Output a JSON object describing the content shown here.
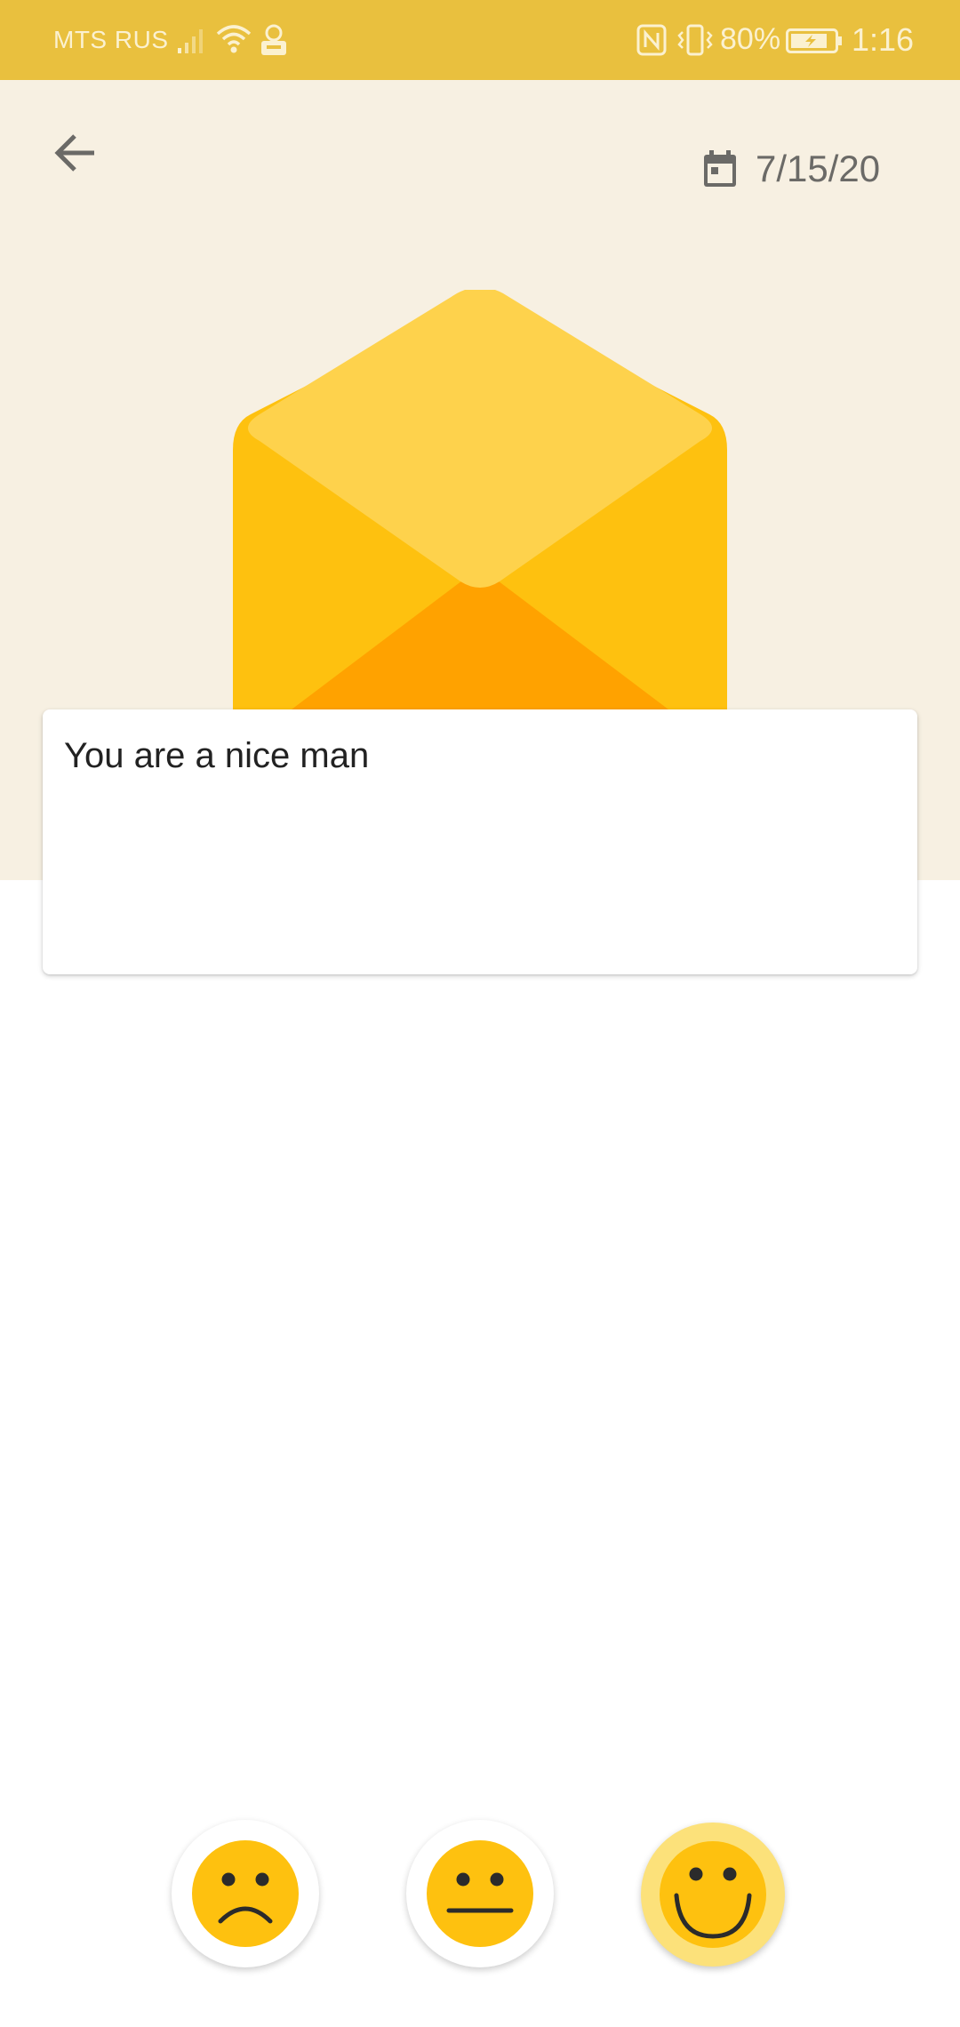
{
  "status_bar": {
    "carrier": "MTS RUS",
    "battery_percent": "80%",
    "time": "1:16",
    "icons": [
      "signal-icon",
      "wifi-icon",
      "vpn-icon",
      "nfc-icon",
      "vibrate-icon",
      "battery-charging-icon"
    ]
  },
  "header": {
    "back_icon": "arrow-left-icon",
    "date_icon": "calendar-icon",
    "date": "7/15/20",
    "illustration": "open-envelope"
  },
  "message": {
    "text": "You are a nice man"
  },
  "moods": [
    {
      "name": "sad",
      "icon": "sad-face-icon",
      "selected": false
    },
    {
      "name": "neutral",
      "icon": "neutral-face-icon",
      "selected": false
    },
    {
      "name": "happy",
      "icon": "happy-face-icon",
      "selected": true
    }
  ],
  "colors": {
    "status_bar": "#E9C03E",
    "header_background": "#F7F0E2",
    "envelope_flap": "#FED24C",
    "envelope_body": "#FEC10F",
    "envelope_inner": "#FFA200",
    "mood_face": "#FEC10F",
    "mood_selected_ring": "#FCE17A"
  }
}
